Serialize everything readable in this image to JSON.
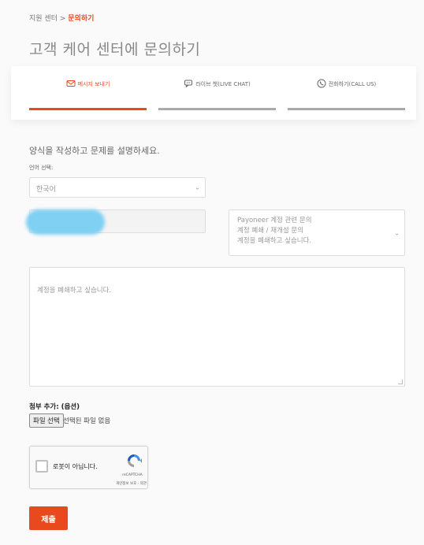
{
  "breadcrumb": {
    "parent": "지원 센터",
    "separator": ">",
    "current": "문의하기"
  },
  "page_title": "고객 케어 센터에 문의하기",
  "tabs": [
    {
      "label": "메시지 보내기",
      "icon": "envelope-icon",
      "active": true
    },
    {
      "label": "라이브 챗(LIVE CHAT)",
      "icon": "chat-icon",
      "active": false
    },
    {
      "label": "전화하기(CALL US)",
      "icon": "phone-icon",
      "active": false
    }
  ],
  "form": {
    "instructions": "양식을 작성하고 문제를 설명하세요.",
    "language_label": "언어 선택:",
    "language_value": "한국어",
    "email_value": "",
    "topic_lines": [
      "Payoneer 계정 관련 문의",
      "계정 폐쇄 / 재개설 문의",
      "계정을 폐쇄하고 싶습니다."
    ],
    "message_value": "계정을 폐쇄하고 싶습니다.",
    "attachment_label": "첨부 추가: (옵션)",
    "file_button_label": "파일 선택",
    "file_status": "선택된 파일 없음",
    "captcha": {
      "label": "로봇이 아닙니다.",
      "brand": "reCAPTCHA",
      "terms": "개인정보 보호 - 약관"
    },
    "submit_label": "제출"
  },
  "colors": {
    "accent": "#e8491d",
    "redaction": "#7fd0f3"
  }
}
